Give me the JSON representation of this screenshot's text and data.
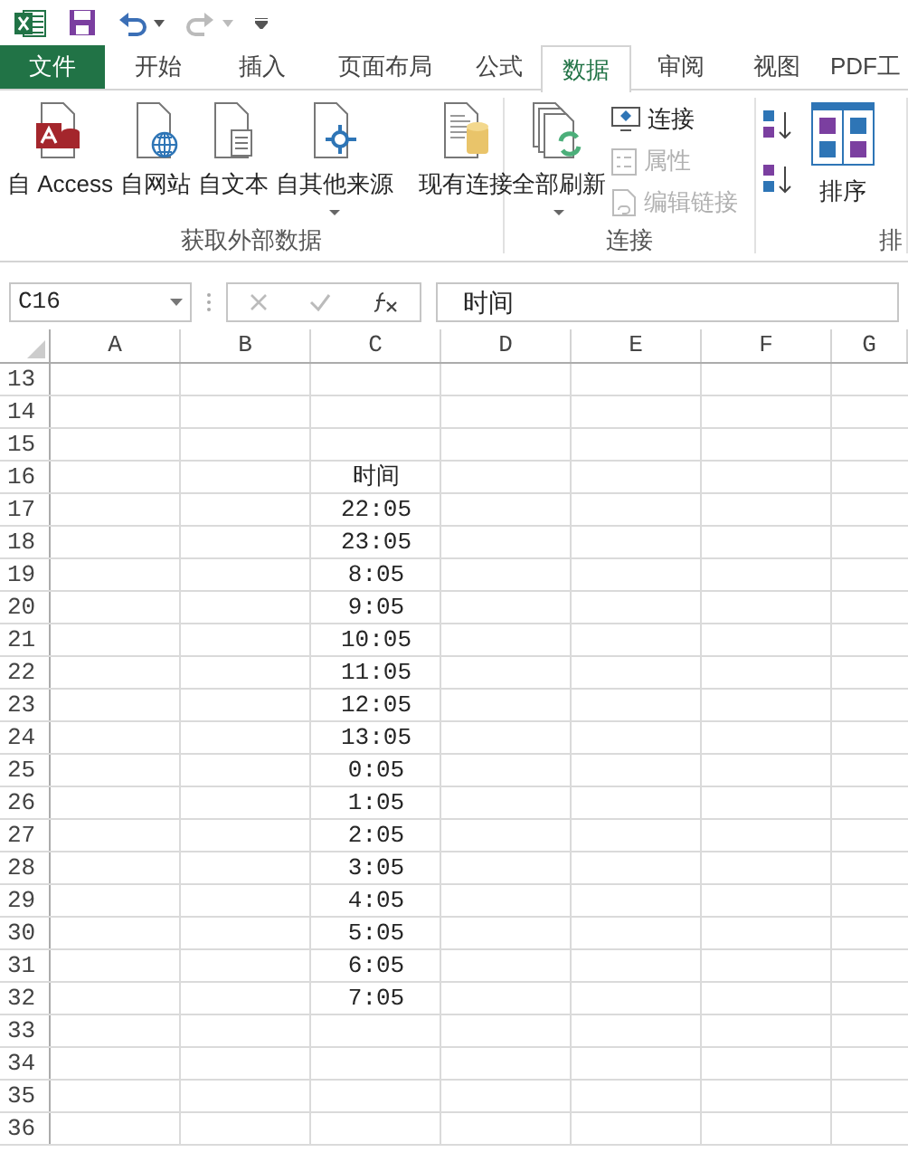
{
  "tabs": [
    {
      "label": "文件",
      "kind": "file",
      "selected": false
    },
    {
      "label": "开始",
      "kind": "tab",
      "selected": false
    },
    {
      "label": "插入",
      "kind": "tab",
      "selected": false
    },
    {
      "label": "页面布局",
      "kind": "tab",
      "selected": false
    },
    {
      "label": "公式",
      "kind": "tab",
      "selected": false
    },
    {
      "label": "数据",
      "kind": "tab",
      "selected": true
    },
    {
      "label": "审阅",
      "kind": "tab",
      "selected": false
    },
    {
      "label": "视图",
      "kind": "tab",
      "selected": false
    },
    {
      "label": "PDF工",
      "kind": "tab",
      "selected": false
    }
  ],
  "ribbon": {
    "groups": [
      {
        "label": "获取外部数据",
        "items": [
          {
            "kind": "large",
            "label": "自 Access",
            "dropdown": false
          },
          {
            "kind": "large",
            "label": "自网站",
            "dropdown": false
          },
          {
            "kind": "large",
            "label": "自文本",
            "dropdown": false
          },
          {
            "kind": "large",
            "label": "自其他来源",
            "dropdown": true
          },
          {
            "kind": "separator"
          },
          {
            "kind": "large",
            "label": "现有连接",
            "dropdown": false
          }
        ]
      },
      {
        "label": "连接",
        "items": [
          {
            "kind": "large",
            "label": "全部刷新",
            "dropdown": true
          },
          {
            "kind": "stack",
            "buttons": [
              {
                "label": "连接",
                "disabled": false
              },
              {
                "label": "属性",
                "disabled": true
              },
              {
                "label": "编辑链接",
                "disabled": true
              }
            ]
          }
        ]
      },
      {
        "label": "排",
        "items": [
          {
            "kind": "sortsmall"
          },
          {
            "kind": "large",
            "label": "排序",
            "dropdown": false
          }
        ]
      }
    ]
  },
  "formula_bar": {
    "name_box": "C16",
    "value": "时间"
  },
  "columns": [
    "A",
    "B",
    "C",
    "D",
    "E",
    "F",
    "G"
  ],
  "rows": [
    {
      "header": "13"
    },
    {
      "header": "14"
    },
    {
      "header": "15"
    },
    {
      "header": "16",
      "c": "时间"
    },
    {
      "header": "17",
      "c": "22:05"
    },
    {
      "header": "18",
      "c": "23:05"
    },
    {
      "header": "19",
      "c": "8:05"
    },
    {
      "header": "20",
      "c": "9:05"
    },
    {
      "header": "21",
      "c": "10:05"
    },
    {
      "header": "22",
      "c": "11:05"
    },
    {
      "header": "23",
      "c": "12:05"
    },
    {
      "header": "24",
      "c": "13:05"
    },
    {
      "header": "25",
      "c": "0:05"
    },
    {
      "header": "26",
      "c": "1:05"
    },
    {
      "header": "27",
      "c": "2:05"
    },
    {
      "header": "28",
      "c": "3:05"
    },
    {
      "header": "29",
      "c": "4:05"
    },
    {
      "header": "30",
      "c": "5:05"
    },
    {
      "header": "31",
      "c": "6:05"
    },
    {
      "header": "32",
      "c": "7:05"
    },
    {
      "header": "33"
    },
    {
      "header": "34"
    },
    {
      "header": "35"
    },
    {
      "header": "36"
    }
  ]
}
